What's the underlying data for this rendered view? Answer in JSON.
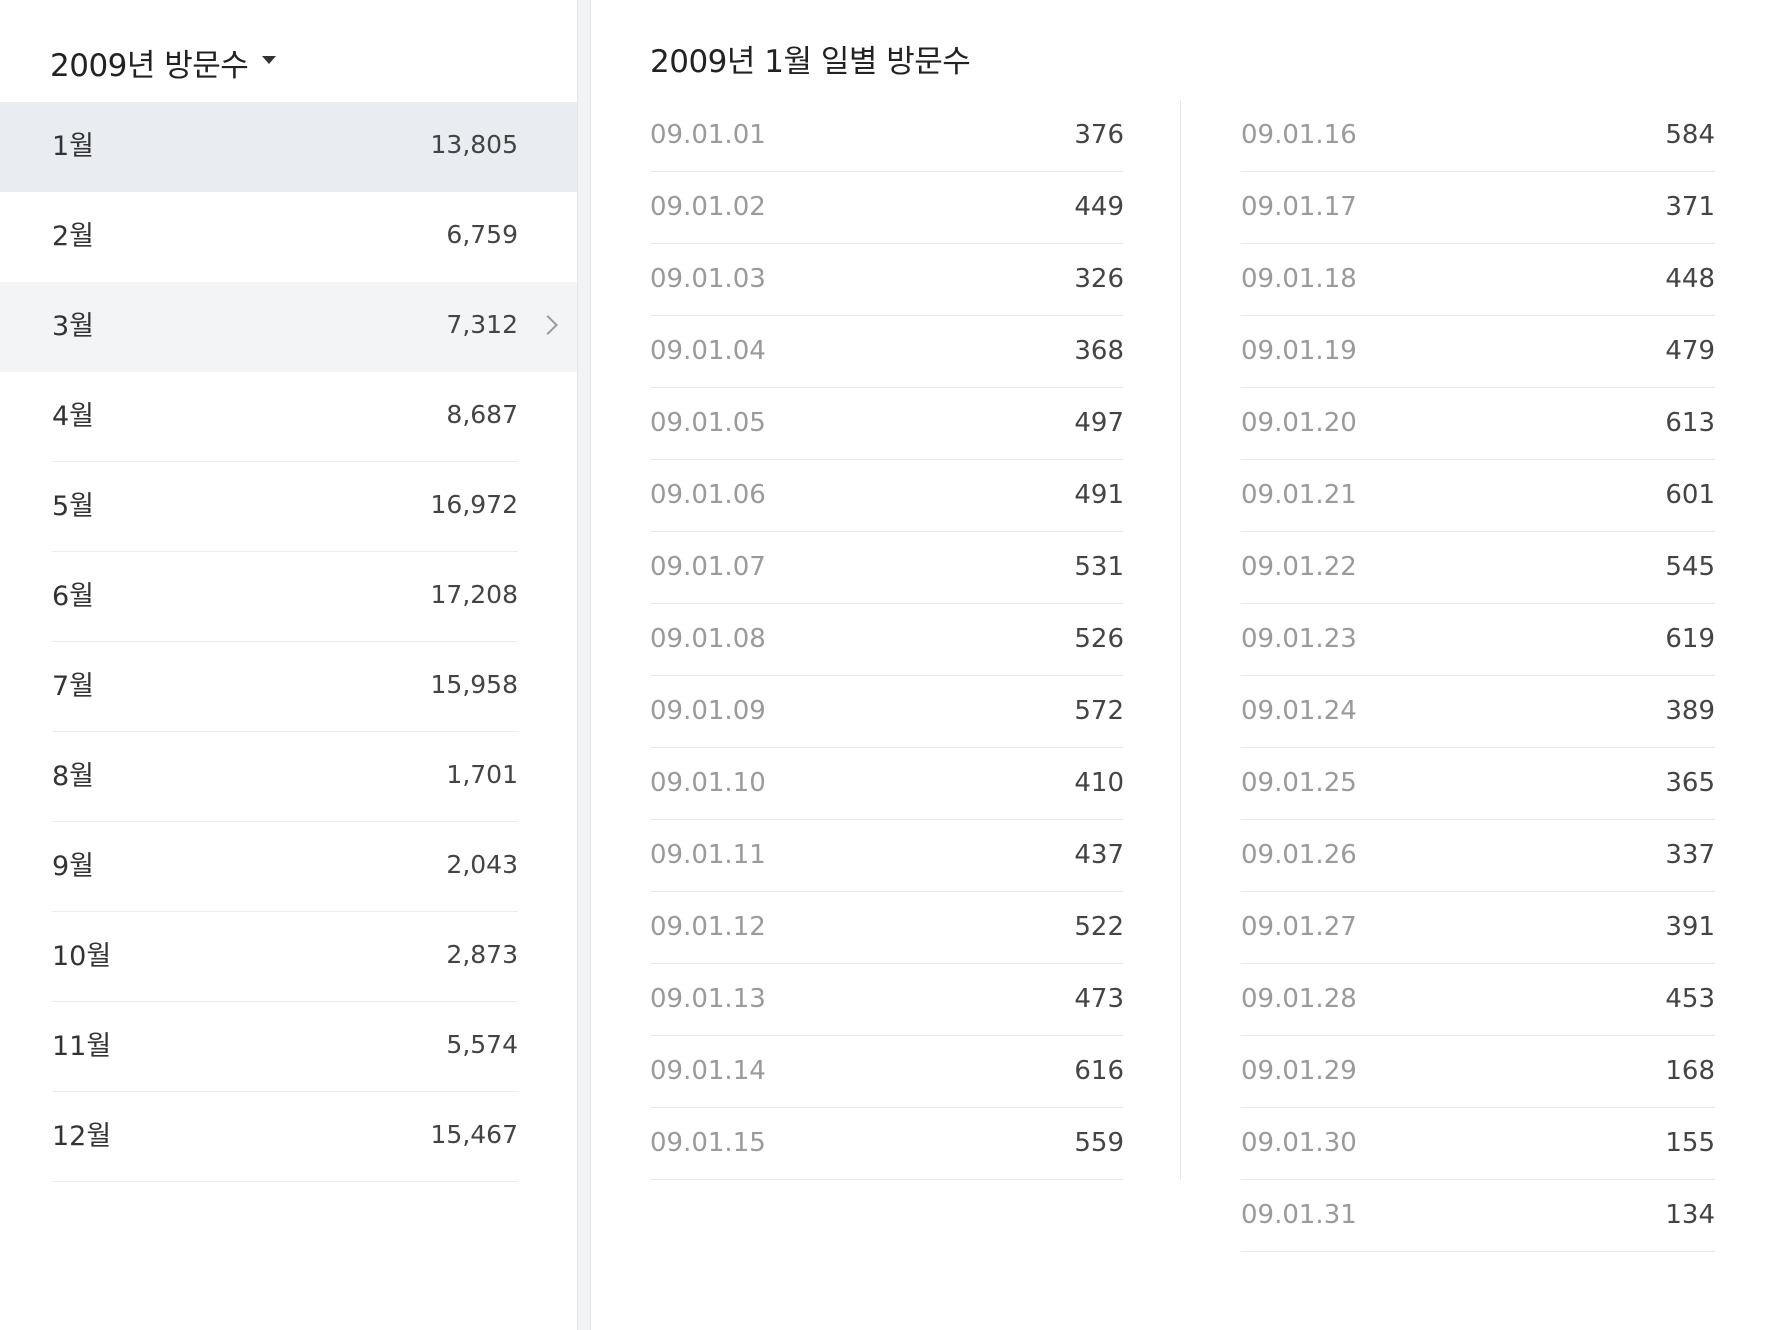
{
  "year_selector": {
    "label": "2009년 방문수",
    "icon": "caret-down-icon"
  },
  "months": [
    {
      "name": "1월",
      "value": "13,805",
      "state": "selected"
    },
    {
      "name": "2월",
      "value": "6,759",
      "state": "normal"
    },
    {
      "name": "3월",
      "value": "7,312",
      "state": "hover"
    },
    {
      "name": "4월",
      "value": "8,687",
      "state": "normal"
    },
    {
      "name": "5월",
      "value": "16,972",
      "state": "normal"
    },
    {
      "name": "6월",
      "value": "17,208",
      "state": "normal"
    },
    {
      "name": "7월",
      "value": "15,958",
      "state": "normal"
    },
    {
      "name": "8월",
      "value": "1,701",
      "state": "normal"
    },
    {
      "name": "9월",
      "value": "2,043",
      "state": "normal"
    },
    {
      "name": "10월",
      "value": "2,873",
      "state": "normal"
    },
    {
      "name": "11월",
      "value": "5,574",
      "state": "normal"
    },
    {
      "name": "12월",
      "value": "15,467",
      "state": "normal"
    }
  ],
  "hover_icon": "chevron-right-icon",
  "daily": {
    "title": "2009년 1월 일별 방문수",
    "left_column": [
      {
        "date": "09.01.01",
        "value": "376"
      },
      {
        "date": "09.01.02",
        "value": "449"
      },
      {
        "date": "09.01.03",
        "value": "326"
      },
      {
        "date": "09.01.04",
        "value": "368"
      },
      {
        "date": "09.01.05",
        "value": "497"
      },
      {
        "date": "09.01.06",
        "value": "491"
      },
      {
        "date": "09.01.07",
        "value": "531"
      },
      {
        "date": "09.01.08",
        "value": "526"
      },
      {
        "date": "09.01.09",
        "value": "572"
      },
      {
        "date": "09.01.10",
        "value": "410"
      },
      {
        "date": "09.01.11",
        "value": "437"
      },
      {
        "date": "09.01.12",
        "value": "522"
      },
      {
        "date": "09.01.13",
        "value": "473"
      },
      {
        "date": "09.01.14",
        "value": "616"
      },
      {
        "date": "09.01.15",
        "value": "559"
      }
    ],
    "right_column": [
      {
        "date": "09.01.16",
        "value": "584"
      },
      {
        "date": "09.01.17",
        "value": "371"
      },
      {
        "date": "09.01.18",
        "value": "448"
      },
      {
        "date": "09.01.19",
        "value": "479"
      },
      {
        "date": "09.01.20",
        "value": "613"
      },
      {
        "date": "09.01.21",
        "value": "601"
      },
      {
        "date": "09.01.22",
        "value": "545"
      },
      {
        "date": "09.01.23",
        "value": "619"
      },
      {
        "date": "09.01.24",
        "value": "389"
      },
      {
        "date": "09.01.25",
        "value": "365"
      },
      {
        "date": "09.01.26",
        "value": "337"
      },
      {
        "date": "09.01.27",
        "value": "391"
      },
      {
        "date": "09.01.28",
        "value": "453"
      },
      {
        "date": "09.01.29",
        "value": "168"
      },
      {
        "date": "09.01.30",
        "value": "155"
      },
      {
        "date": "09.01.31",
        "value": "134"
      }
    ]
  },
  "colors": {
    "selected_row_bg": "#e9ecf1",
    "hover_row_bg": "#f3f4f6",
    "date_text": "#9a9a9a",
    "value_text": "#444444"
  }
}
